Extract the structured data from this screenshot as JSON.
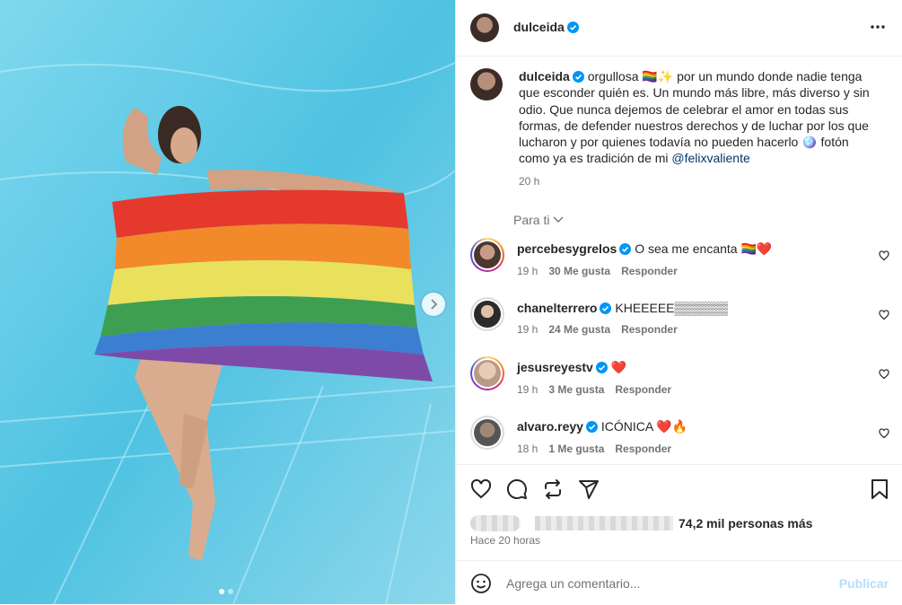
{
  "post": {
    "author": "dulceida",
    "caption_parts": [
      "orgullosa 🏳️‍🌈✨ por un mundo donde nadie tenga que esconder quién es. Un mundo más libre, más diverso y sin odio. Que nunca dejemos de celebrar el amor en todas sus formas, de defender nuestros derechos y de luchar por los que lucharon y por quienes todavía no pueden hacerlo 🪩 fotón como ya es tradición de mi ",
      "@felixvaliente"
    ],
    "caption_time": "20 h"
  },
  "filter_label": "Para ti",
  "comments": [
    {
      "user": "percebesygrelos",
      "text": "O sea me encanta 🏳️‍🌈❤️",
      "time": "19 h",
      "likes": "30 Me gusta",
      "reply": "Responder"
    },
    {
      "user": "chanelterrero",
      "text": "KHEEEEE▒▒▒▒▒▒",
      "time": "19 h",
      "likes": "24 Me gusta",
      "reply": "Responder"
    },
    {
      "user": "jesusreyestv",
      "text": "❤️",
      "time": "19 h",
      "likes": "3 Me gusta",
      "reply": "Responder"
    },
    {
      "user": "alvaro.reyy",
      "text": "ICÓNICA ❤️🔥",
      "time": "18 h",
      "likes": "1 Me gusta",
      "reply": "Responder"
    }
  ],
  "likes_summary": "74,2 mil personas más",
  "posted_ago": "Hace 20 horas",
  "add_comment_placeholder": "Agrega un comentario...",
  "publish_label": "Publicar",
  "colors": {
    "accent": "#0095f6",
    "publish_disabled": "#b2dffc",
    "verified": "#0095f6"
  }
}
